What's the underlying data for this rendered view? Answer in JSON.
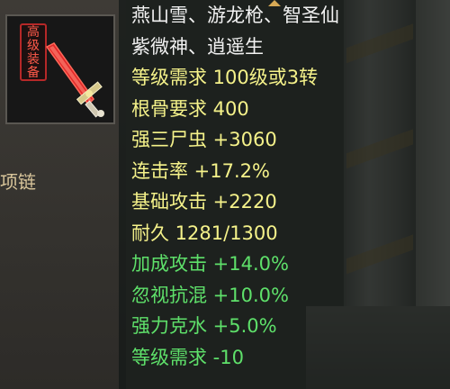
{
  "background": {
    "left_panel_text": "项链"
  },
  "item": {
    "icon": "red-sword-icon",
    "badge_chars": [
      "高",
      "级",
      "装",
      "备"
    ],
    "badge_color": "#b62828"
  },
  "tooltip": {
    "scroll_indicator": "chevron-up-icon",
    "colors": {
      "white": "#f2f2f2",
      "yellow": "#f5f28a",
      "green": "#5ee06a"
    },
    "lines": [
      {
        "text": "燕山雪、游龙枪、智圣仙",
        "color": "white"
      },
      {
        "text": "紫微神、逍遥生",
        "color": "white"
      },
      {
        "text": "等级需求 100级或3转",
        "color": "yellow"
      },
      {
        "text": "根骨要求 400",
        "color": "yellow"
      },
      {
        "text": "强三尸虫 +3060",
        "color": "yellow"
      },
      {
        "text": "连击率 +17.2%",
        "color": "yellow"
      },
      {
        "text": "基础攻击 +2220",
        "color": "yellow"
      },
      {
        "text": "耐久 1281/1300",
        "color": "yellow"
      },
      {
        "text": "加成攻击 +14.0%",
        "color": "green"
      },
      {
        "text": "忽视抗混 +10.0%",
        "color": "green"
      },
      {
        "text": "强力克水 +5.0%",
        "color": "green"
      },
      {
        "text": "等级需求 -10",
        "color": "green"
      }
    ]
  }
}
